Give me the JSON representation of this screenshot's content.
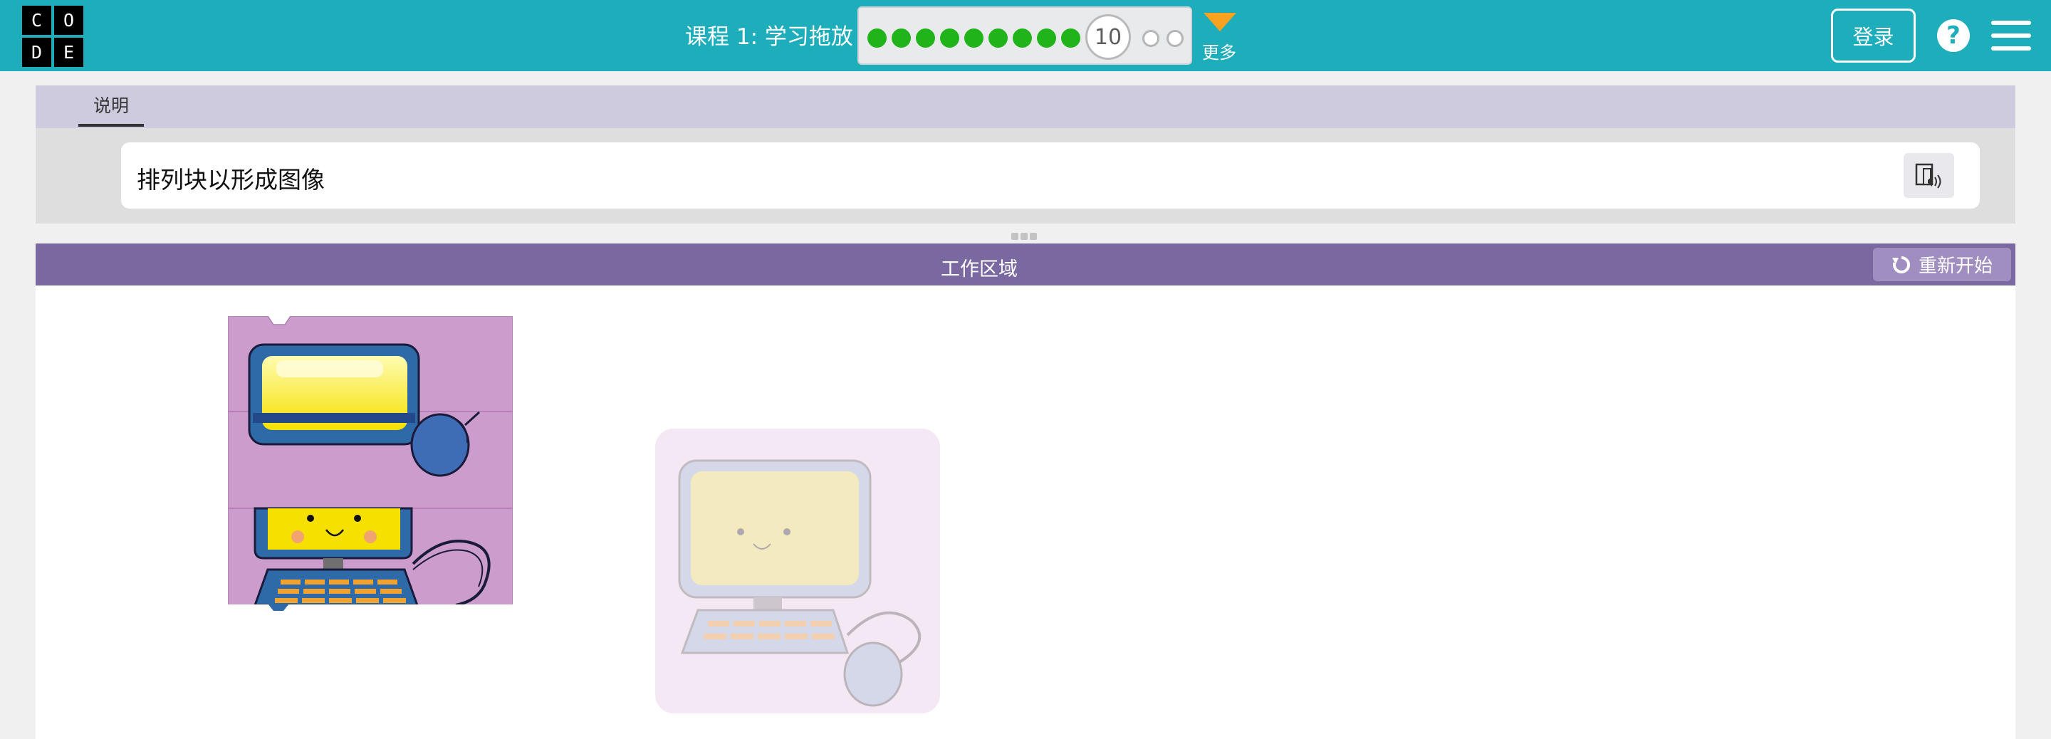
{
  "logo": {
    "letters": [
      "C",
      "O",
      "D",
      "E"
    ]
  },
  "header": {
    "lesson_title": "课程 1: 学习拖放",
    "current_level": "10",
    "more_label": "更多",
    "login_label": "登录",
    "help_label": "?",
    "progress": {
      "completed_levels": 9,
      "current_level": 10,
      "remaining_levels": 2
    }
  },
  "instructions": {
    "tab_label": "说明",
    "text": "排列块以形成图像"
  },
  "workspace": {
    "title": "工作区域",
    "reset_label": "重新开始"
  },
  "colors": {
    "header_bg": "#1eadbb",
    "progress_done": "#20b41a",
    "more_arrow": "#f9a21f",
    "instructions_tab_bg": "#cfcbdf",
    "workspace_header_bg": "#7a68a1",
    "puzzle_bg": "#cc9ccc"
  },
  "icons": [
    "help-icon",
    "hamburger-menu-icon",
    "text-to-speech-icon",
    "restart-icon",
    "dropdown-triangle-icon",
    "drag-handle-icon"
  ]
}
